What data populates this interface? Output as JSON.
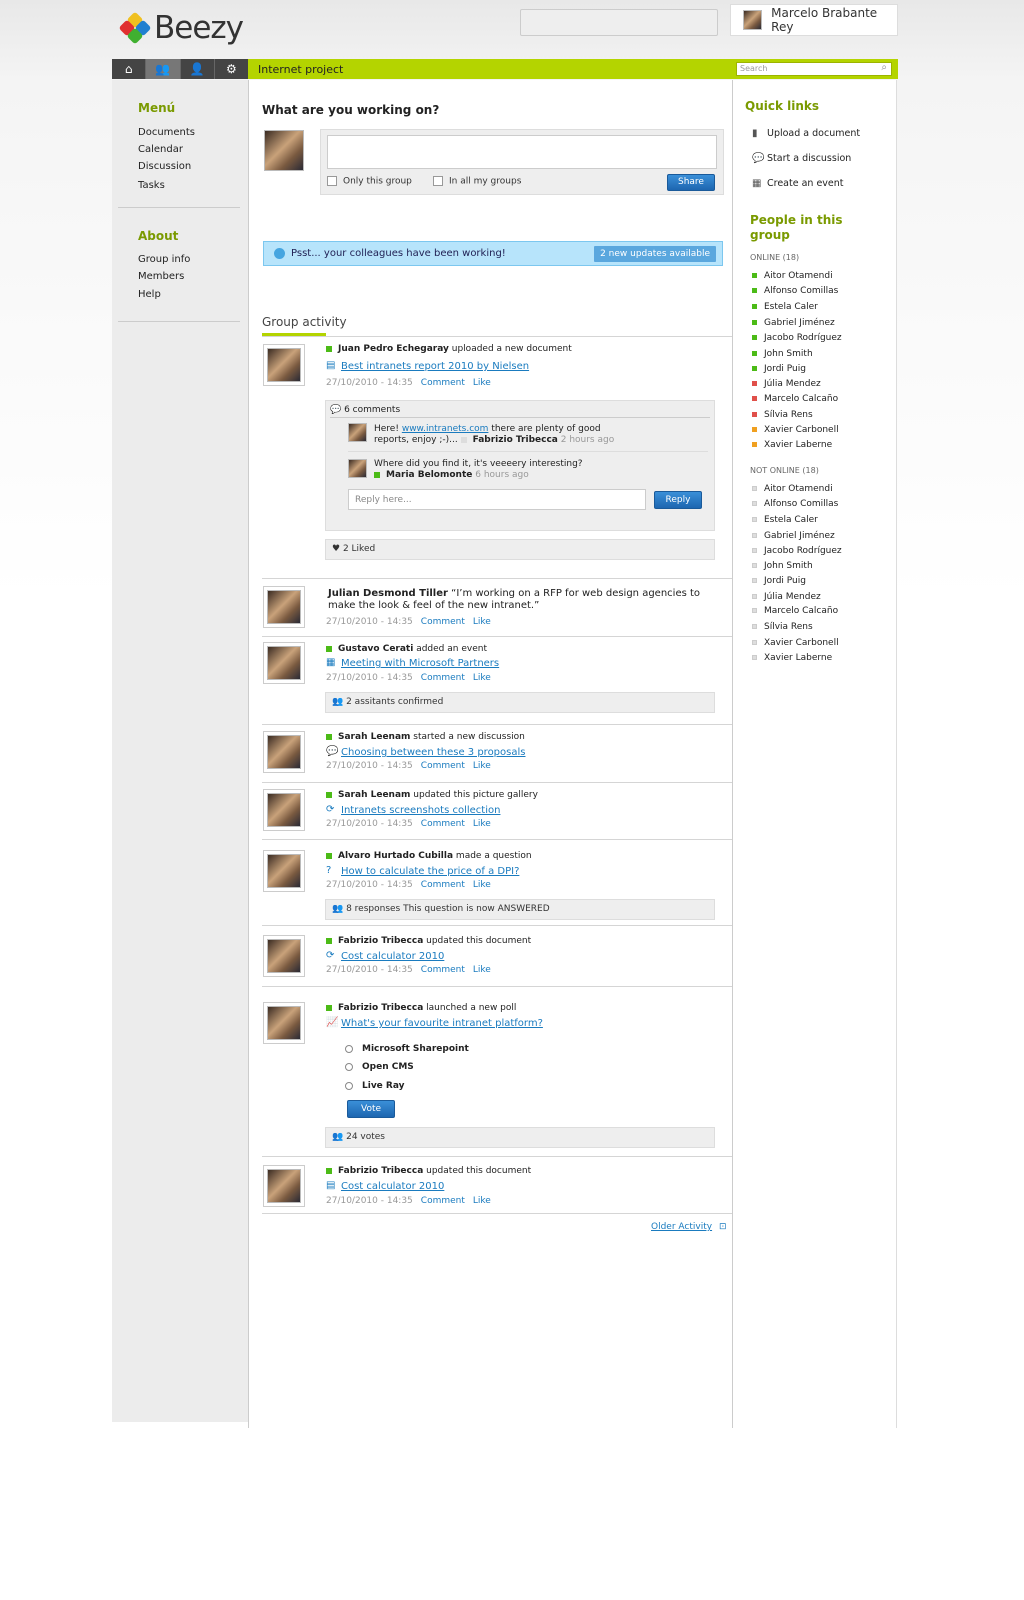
{
  "header": {
    "brand": "Beezy",
    "user_name": "Marcelo Brabante Rey",
    "search_value": ""
  },
  "nav": {
    "tabs": [
      "home-icon",
      "group-icon",
      "user-icon",
      "gear-icon"
    ],
    "active_tab": 1
  },
  "group": {
    "title": "Internet project",
    "search_placeholder": "Search"
  },
  "sidebar": {
    "menu_title": "Menú",
    "menu_items": [
      "Documents",
      "Calendar",
      "Discussion",
      "Tasks"
    ],
    "about_title": "About",
    "about_items": [
      "Group info",
      "Members",
      "Help"
    ]
  },
  "composer": {
    "prompt": "What are you working on?",
    "opt1": "Only this group",
    "opt2": "In all my groups",
    "share": "Share"
  },
  "notice": {
    "text": "Psst... your colleagues have been working!",
    "button": "2 new updates available"
  },
  "activity": {
    "title": "Group activity",
    "comment_label": "Comment",
    "like_label": "Like",
    "items": [
      {
        "name": "Juan Pedro Echegaray",
        "action": "uploaded a new document",
        "link": "Best intranets report 2010 by Nielsen",
        "date": "27/10/2010 - 14:35"
      },
      {
        "name": "Julian Desmond Tiller",
        "quote": "“I’m working on a RFP for web design agencies to make the look & feel of the new intranet.”",
        "date": "27/10/2010 - 14:35"
      },
      {
        "name": "Gustavo Cerati",
        "action": "added an event",
        "link": "Meeting with Microsoft Partners",
        "date": "27/10/2010 - 14:35",
        "strip": "2 assitants confirmed"
      },
      {
        "name": "Sarah Leenam",
        "action": "started a new discussion",
        "link": "Choosing between these 3 proposals",
        "date": "27/10/2010 - 14:35"
      },
      {
        "name": "Sarah Leenam",
        "action": "updated this picture gallery",
        "link": "Intranets screenshots collection",
        "date": "27/10/2010 - 14:35"
      },
      {
        "name": "Alvaro Hurtado Cubilla",
        "action": "made a question",
        "link": "How to calculate the price of a DPI?",
        "date": "27/10/2010 - 14:35",
        "strip": "8 responses This question is now ANSWERED"
      },
      {
        "name": "Fabrizio Tribecca",
        "action": "updated this document",
        "link": "Cost calculator 2010",
        "date": "27/10/2010 - 14:35"
      },
      {
        "name": "Fabrizio Tribecca",
        "action": "launched a new poll",
        "link": "What's your favourite intranet platform?",
        "options": [
          "Microsoft Sharepoint",
          "Open CMS",
          "Live Ray"
        ],
        "vote": "Vote",
        "strip": "24 votes"
      },
      {
        "name": "Fabrizio Tribecca",
        "action": "updated this document",
        "link": "Cost calculator 2010",
        "date": "27/10/2010 - 14:35"
      }
    ],
    "comments": {
      "count": "6 comments",
      "c1_pre": "Here!",
      "c1_link": "www.intranets.com",
      "c1_post": "there are plenty of good reports, enjoy ;-)...",
      "c1_name": "Fabrizio Tribecca",
      "c1_time": "2 hours ago",
      "c2_text": "Where did you find it, it's veeeery interesting?",
      "c2_name": "Maria Belomonte",
      "c2_time": "6 hours ago",
      "reply_placeholder": "Reply here...",
      "reply": "Reply",
      "liked": "2 Liked"
    },
    "older": "Older Activity"
  },
  "quick_links": {
    "title": "Quick links",
    "items": [
      "Upload a document",
      "Start a discussion",
      "Create an event"
    ]
  },
  "people": {
    "title": "People in this group",
    "online_label": "ONLINE (18)",
    "online": [
      {
        "n": "Aitor Otamendi",
        "c": "#4cbb17"
      },
      {
        "n": "Alfonso Comillas",
        "c": "#4cbb17"
      },
      {
        "n": "Estela Caler",
        "c": "#4cbb17"
      },
      {
        "n": "Gabriel Jiménez",
        "c": "#4cbb17"
      },
      {
        "n": "Jacobo Rodríguez",
        "c": "#4cbb17"
      },
      {
        "n": "John Smith",
        "c": "#4cbb17"
      },
      {
        "n": "Jordi Puig",
        "c": "#4cbb17"
      },
      {
        "n": "Júlia Mendez",
        "c": "#e0504a"
      },
      {
        "n": "Marcelo Calcaño",
        "c": "#e0504a"
      },
      {
        "n": "Sílvia Rens",
        "c": "#e0504a"
      },
      {
        "n": "Xavier Carbonell",
        "c": "#f0a020"
      },
      {
        "n": "Xavier Laberne",
        "c": "#f0a020"
      }
    ],
    "offline_label": "NOT ONLINE (18)",
    "offline": [
      "Aitor Otamendi",
      "Alfonso Comillas",
      "Estela Caler",
      "Gabriel Jiménez",
      "Jacobo Rodríguez",
      "John Smith",
      "Jordi Puig",
      "Júlia Mendez",
      "Marcelo Calcaño",
      "Sílvia Rens",
      "Xavier Carbonell",
      "Xavier Laberne"
    ]
  }
}
